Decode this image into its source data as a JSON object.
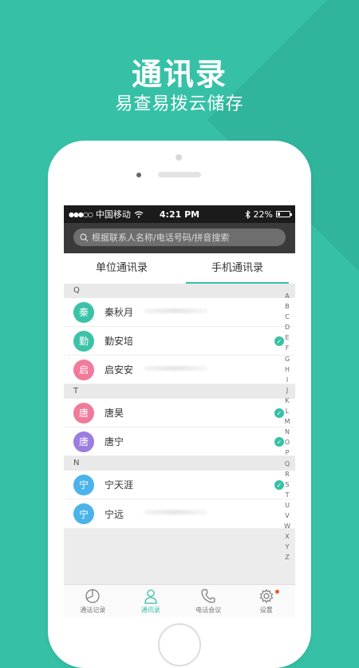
{
  "promo": {
    "title": "通讯录",
    "subtitle": "易查易拨云储存"
  },
  "status_bar": {
    "signal": "●●●○○",
    "carrier": "中国移动",
    "time": "4:21 PM",
    "battery": "22%"
  },
  "search": {
    "placeholder": "根据联系人名称/电话号码/拼音搜索"
  },
  "tabs": [
    {
      "label": "单位通讯录",
      "active": false
    },
    {
      "label": "手机通讯录",
      "active": true
    }
  ],
  "sections": [
    {
      "letter": "Q",
      "contacts": [
        {
          "avatar": "秦",
          "name": "秦秋月",
          "color": "#3cc3a7",
          "checked": false
        },
        {
          "avatar": "勤",
          "name": "勤安培",
          "color": "#3cc3a7",
          "checked": true
        },
        {
          "avatar": "启",
          "name": "启安安",
          "color": "#f07a9a",
          "checked": false
        }
      ]
    },
    {
      "letter": "T",
      "contacts": [
        {
          "avatar": "唐",
          "name": "唐昊",
          "color": "#f07a9a",
          "checked": true
        },
        {
          "avatar": "唐",
          "name": "唐宁",
          "color": "#9b7de0",
          "checked": true
        }
      ]
    },
    {
      "letter": "N",
      "contacts": [
        {
          "avatar": "宁",
          "name": "宁天涯",
          "color": "#4bb3ea",
          "checked": true
        },
        {
          "avatar": "宁",
          "name": "宁远",
          "color": "#4bb3ea",
          "checked": false
        }
      ]
    }
  ],
  "index_letters": [
    "A",
    "B",
    "C",
    "D",
    "E",
    "F",
    "G",
    "H",
    "I",
    "J",
    "K",
    "L",
    "M",
    "N",
    "O",
    "P",
    "Q",
    "R",
    "S",
    "T",
    "U",
    "V",
    "W",
    "X",
    "Y",
    "Z"
  ],
  "bottom_nav": [
    {
      "label": "通话记录",
      "icon": "call-log-icon",
      "active": false
    },
    {
      "label": "通讯录",
      "icon": "contacts-icon",
      "active": true
    },
    {
      "label": "电话会议",
      "icon": "phone-icon",
      "active": false
    },
    {
      "label": "设置",
      "icon": "gear-icon",
      "active": false
    }
  ],
  "colors": {
    "accent": "#36c1a6",
    "background": "#36c1a6"
  }
}
